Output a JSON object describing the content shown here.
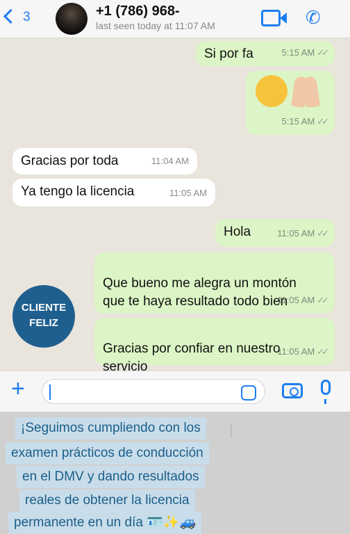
{
  "header": {
    "back_count": "3",
    "contact_name": "+1 (786) 968-",
    "status": "last seen today at 11:07 AM"
  },
  "icons": {
    "back": "chevron-left-icon",
    "video": "video-call-icon",
    "phone": "phone-icon",
    "camera": "camera-icon",
    "mic": "mic-icon",
    "sticker": "sticker-icon",
    "plus": "plus-icon"
  },
  "messages": [
    {
      "dir": "out",
      "text": "Si por fa",
      "time": "5:15 AM"
    },
    {
      "dir": "out",
      "text": "",
      "emoji": [
        "smiling-face",
        "folded-hands"
      ],
      "time": "5:15 AM"
    },
    {
      "dir": "in",
      "text": "Gracias por toda",
      "time": "11:04 AM"
    },
    {
      "dir": "in",
      "text": "Ya tengo la licencia",
      "time": "11:05 AM"
    },
    {
      "dir": "out",
      "text": "Hola",
      "time": "11:05 AM"
    },
    {
      "dir": "out",
      "text": "Que bueno me alegra un montón\nque te haya resultado todo bien",
      "time": "11:05 AM"
    },
    {
      "dir": "out",
      "text": "Gracias por confiar en nuestro\nservicio",
      "time": "11:05 AM"
    }
  ],
  "badge": {
    "line1": "CLIENTE",
    "line2": "FELIZ"
  },
  "composer": {
    "value": ""
  },
  "promo_lines": [
    "¡Seguimos cumpliendo con los",
    "examen prácticos de conducción",
    "en el DMV y dando resultados",
    "reales de obtener la licencia",
    "permanente en un día 🪪✨🚙"
  ],
  "colors": {
    "accent": "#1d7ef0",
    "outgoing": "#dcf5c6",
    "incoming": "#ffffff",
    "badge": "#1f5f8f",
    "promo_text": "#1a5f8a"
  }
}
